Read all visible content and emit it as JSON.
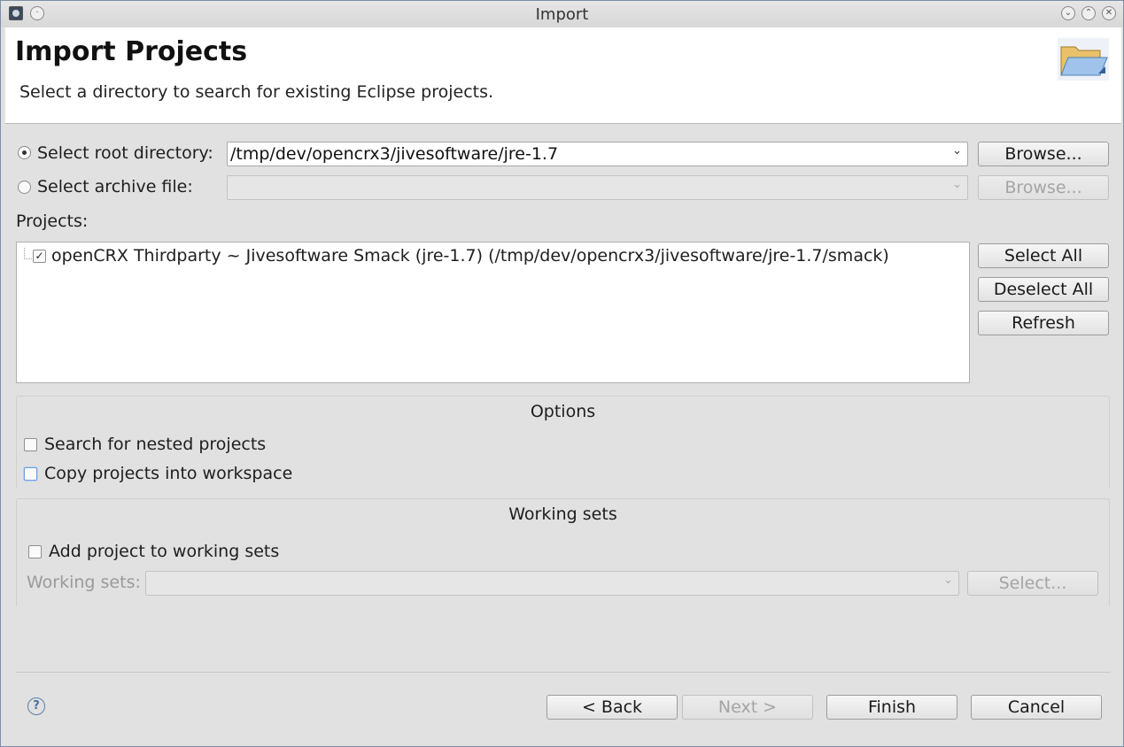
{
  "window": {
    "title": "Import"
  },
  "header": {
    "title": "Import Projects",
    "description": "Select a directory to search for existing Eclipse projects."
  },
  "source": {
    "root_label": "Select root directory:",
    "root_value": "/tmp/dev/opencrx3/jivesoftware/jre-1.7",
    "archive_label": "Select archive file:",
    "archive_value": "",
    "browse_label": "Browse..."
  },
  "projects": {
    "label": "Projects:",
    "items": [
      {
        "label": "openCRX Thirdparty ~ Jivesoftware Smack (jre-1.7) (/tmp/dev/opencrx3/jivesoftware/jre-1.7/smack)",
        "checked": true
      }
    ],
    "select_all": "Select All",
    "deselect_all": "Deselect All",
    "refresh": "Refresh"
  },
  "options": {
    "title": "Options",
    "nested": "Search for nested projects",
    "copy": "Copy projects into workspace"
  },
  "working_sets": {
    "title": "Working sets",
    "add": "Add project to working sets",
    "label": "Working sets:",
    "value": "",
    "select": "Select..."
  },
  "footer": {
    "back": "< Back",
    "next": "Next >",
    "finish": "Finish",
    "cancel": "Cancel"
  }
}
